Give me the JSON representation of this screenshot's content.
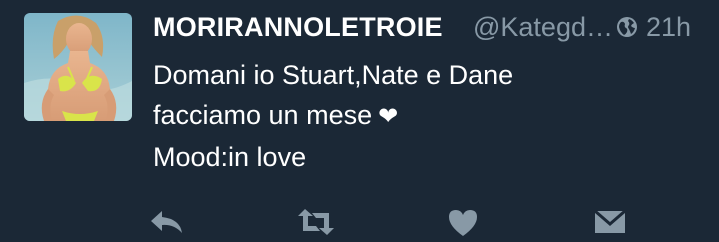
{
  "tweet": {
    "display_name": "MORIRANNOLETROIE",
    "handle": "@Kategd…",
    "time": "21h",
    "globe_icon": "globe-icon",
    "lines": [
      "Domani io Stuart,Nate e Dane",
      "facciamo un mese",
      "Mood:in love"
    ],
    "emoji": "❤"
  },
  "actions": {
    "reply_icon": "reply-icon",
    "retweet_icon": "retweet-icon",
    "like_icon": "heart-icon",
    "dm_icon": "envelope-icon"
  },
  "colors": {
    "background": "#1b2836",
    "primary_text": "#ffffff",
    "secondary_text": "#8899a6",
    "action_icons": "#8899a6"
  }
}
